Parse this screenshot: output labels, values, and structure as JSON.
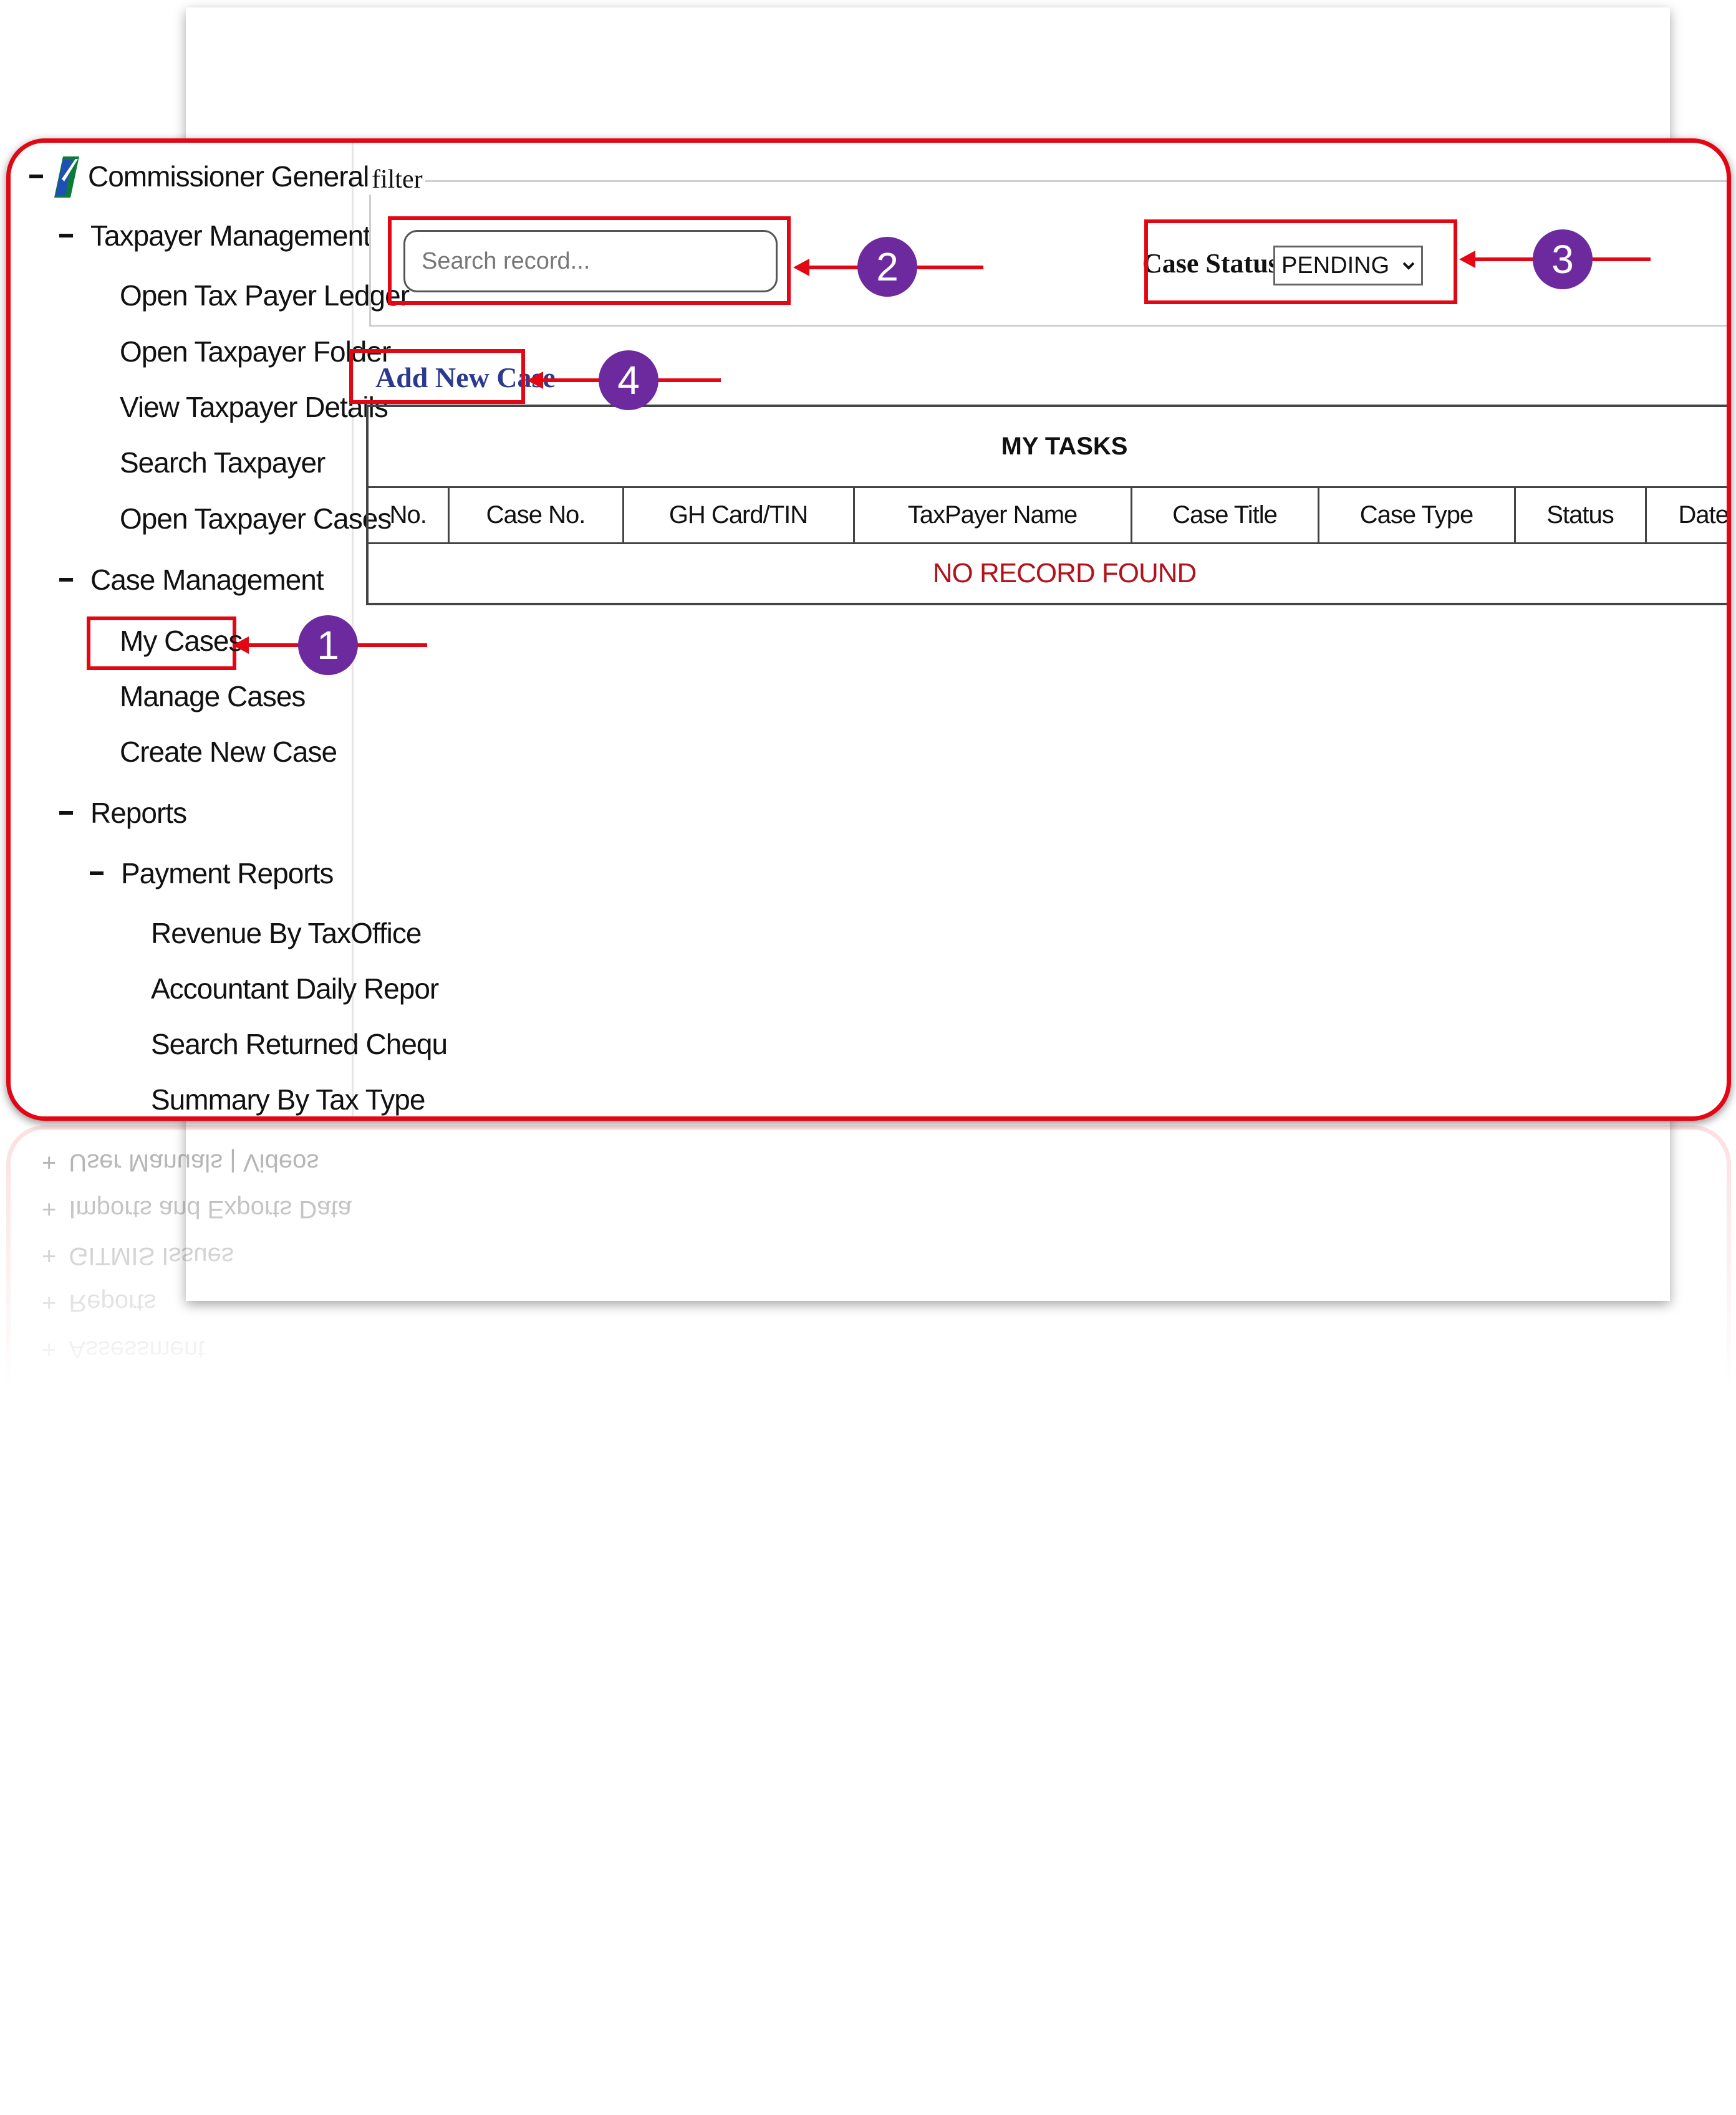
{
  "sidebar": {
    "root": "Commissioner General",
    "taxpayer_management": {
      "label": "Taxpayer Management",
      "items": [
        "Open Tax Payer Ledger",
        "Open Taxpayer Folder",
        "View Taxpayer Details",
        "Search Taxpayer",
        "Open Taxpayer Cases"
      ]
    },
    "case_management": {
      "label": "Case Management",
      "items": [
        "My Cases",
        "Manage Cases",
        "Create New Case"
      ]
    },
    "reports": {
      "label": "Reports",
      "payment_reports": {
        "label": "Payment Reports",
        "items": [
          "Revenue By TaxOffice",
          "Accountant Daily Repor",
          "Search Returned Chequ",
          "Summary By Tax Type"
        ]
      }
    }
  },
  "filter": {
    "legend": "filter",
    "search_placeholder": "Search record...",
    "case_status_label": "Case Status",
    "case_status_value": "PENDING"
  },
  "add_new_case": "Add New Case",
  "table": {
    "title": "MY TASKS",
    "columns": [
      "No.",
      "Case No.",
      "GH Card/TIN",
      "TaxPayer Name",
      "Case Title",
      "Case Type",
      "Status",
      "Date"
    ],
    "empty_message": "NO RECORD FOUND"
  },
  "reflection_items": [
    "User Manuals | Videos",
    "Imports and Exports Data",
    "GITMIS Issues",
    "Reports",
    "Assessment"
  ],
  "annotations": [
    "1",
    "2",
    "3",
    "4"
  ],
  "colors": {
    "annotation_red": "#e30613",
    "badge_purple": "#6d2a9e",
    "link_blue": "#2b3a8f",
    "empty_red": "#b3121b"
  }
}
